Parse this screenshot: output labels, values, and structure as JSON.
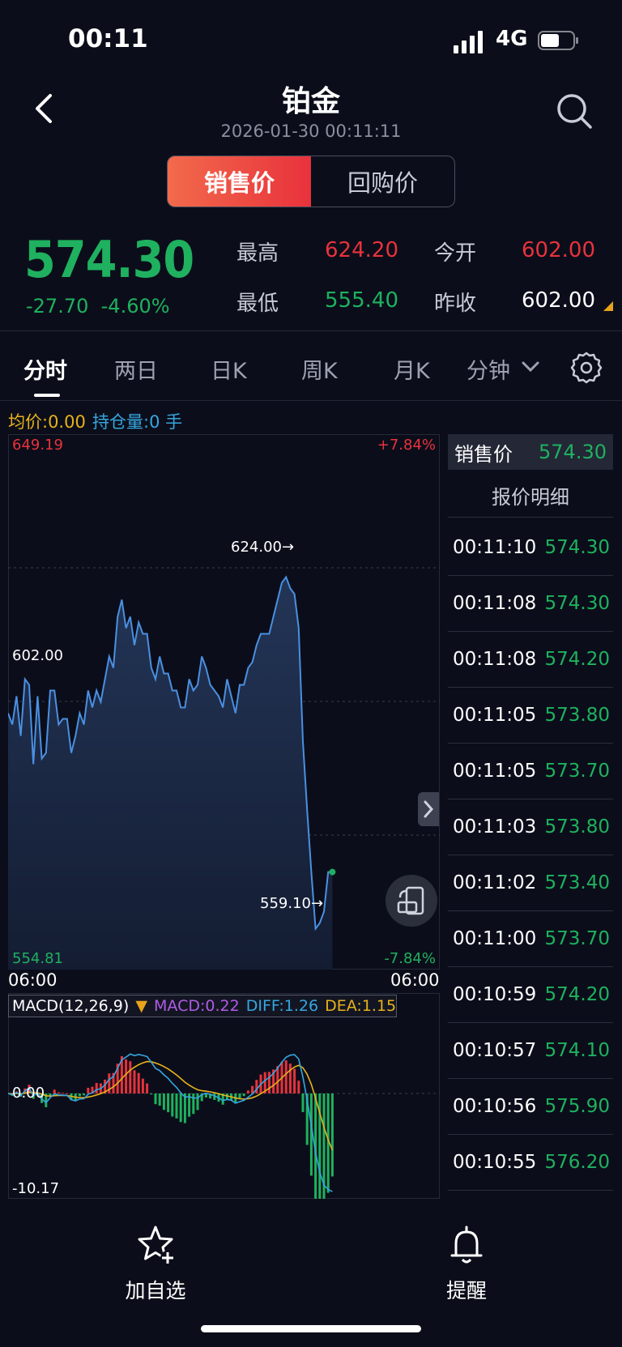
{
  "status_bar": {
    "time": "00:11",
    "network": "4G"
  },
  "header": {
    "title": "铂金",
    "datetime": "2026-01-30 00:11:11"
  },
  "segment": {
    "options": [
      "销售价",
      "回购价"
    ],
    "selected": 0
  },
  "quote": {
    "price": "574.30",
    "change": "-27.70",
    "change_pct": "-4.60%",
    "high_label": "最高",
    "high": "624.20",
    "open_label": "今开",
    "open": "602.00",
    "low_label": "最低",
    "low": "555.40",
    "prev_close_label": "昨收",
    "prev_close": "602.00"
  },
  "tabs": [
    "分时",
    "两日",
    "日K",
    "周K",
    "月K",
    "分钟"
  ],
  "active_tab": 0,
  "legend": {
    "avg": "均价:0.00",
    "position": "持仓量:0 手"
  },
  "main_chart": {
    "ymax": "649.19",
    "ymax_pct": "+7.84%",
    "ymin": "554.81",
    "ymin_pct": "-7.84%",
    "ref": "602.00",
    "high_marker": "624.00→",
    "low_marker": "559.10→",
    "x_start": "06:00",
    "x_end": "06:00"
  },
  "macd": {
    "params": "MACD(12,26,9)",
    "macd": "MACD:0.22",
    "diff": "DIFF:1.26",
    "dea": "DEA:1.15",
    "zero": "0.00",
    "min": "-10.17"
  },
  "chart_data": {
    "type": "line",
    "title": "",
    "ylim": [
      554.81,
      649.19
    ],
    "reference": 602.0,
    "annotations": [
      {
        "label": "624.00",
        "value": 624.0
      },
      {
        "label": "559.10",
        "value": 559.1
      }
    ],
    "series": [
      {
        "values": [
          600,
          598,
          603,
          596,
          606,
          605,
          591,
          603,
          592,
          593,
          604,
          604,
          598,
          599,
          599,
          593,
          596,
          600,
          598,
          604,
          601,
          604,
          602,
          606,
          610,
          608,
          617,
          620,
          615,
          617,
          612,
          616,
          614,
          614,
          608,
          606,
          610,
          607,
          607,
          604,
          604,
          601,
          601,
          606,
          604,
          605,
          610,
          608,
          605,
          604,
          603,
          601,
          606,
          603,
          600,
          605,
          605,
          608,
          609,
          612,
          614,
          614,
          614,
          617,
          620,
          623,
          624,
          622,
          621,
          615,
          595,
          583,
          572,
          562,
          563,
          565,
          572,
          572
        ]
      }
    ]
  },
  "quote_panel": {
    "header_label": "销售价",
    "header_value": "574.30",
    "title": "报价明细",
    "rows": [
      {
        "time": "00:11:10",
        "price": "574.30"
      },
      {
        "time": "00:11:08",
        "price": "574.30"
      },
      {
        "time": "00:11:08",
        "price": "574.20"
      },
      {
        "time": "00:11:05",
        "price": "573.80"
      },
      {
        "time": "00:11:05",
        "price": "573.70"
      },
      {
        "time": "00:11:03",
        "price": "573.80"
      },
      {
        "time": "00:11:02",
        "price": "573.40"
      },
      {
        "time": "00:11:00",
        "price": "573.70"
      },
      {
        "time": "00:10:59",
        "price": "574.20"
      },
      {
        "time": "00:10:57",
        "price": "574.10"
      },
      {
        "time": "00:10:56",
        "price": "575.90"
      },
      {
        "time": "00:10:55",
        "price": "576.20"
      }
    ]
  },
  "bottom": {
    "add_watch": "加自选",
    "alert": "提醒"
  },
  "colors": {
    "up": "#e8323c",
    "down": "#1fb15f",
    "line": "#4a90e2",
    "avg": "#e8b21b",
    "position": "#36a6e0",
    "macd": "#b05be6",
    "diff": "#36a6e0",
    "dea": "#e8b21b"
  }
}
